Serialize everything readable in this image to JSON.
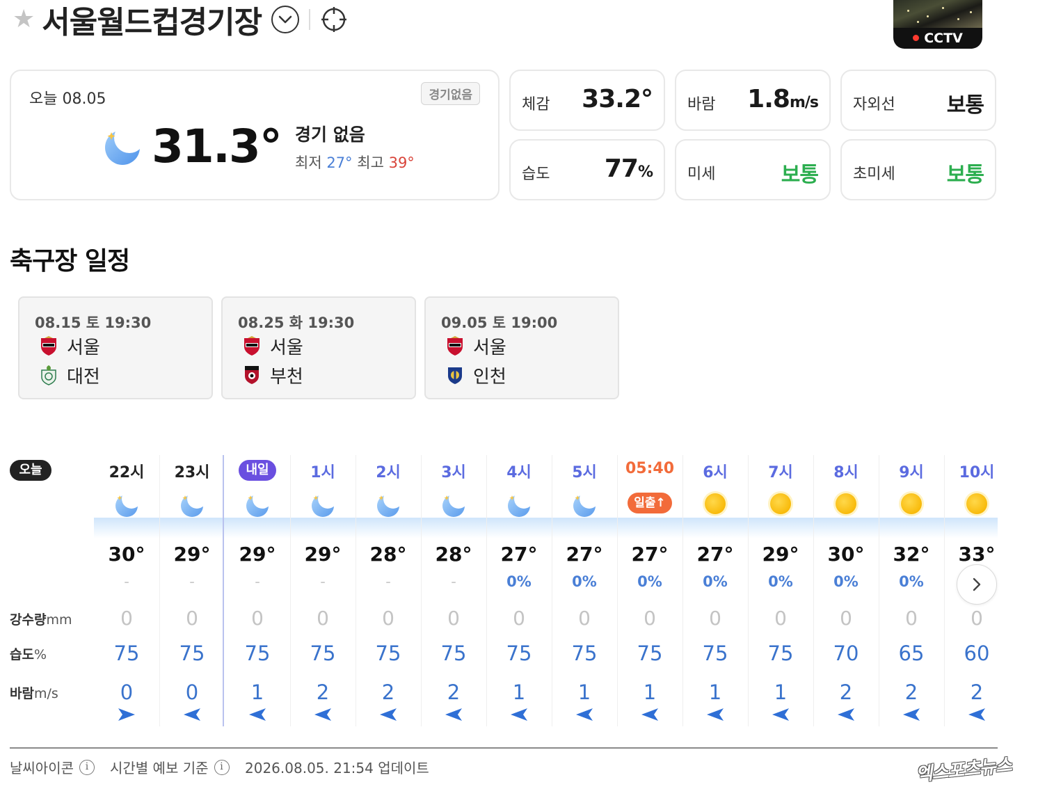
{
  "header": {
    "stadium_name": "서울월드컵경기장",
    "cctv_label": "CCTV"
  },
  "current": {
    "date_label": "오늘 08.05",
    "badge": "경기없음",
    "temp": "31.3°",
    "game_status": "경기 없음",
    "min_label": "최저",
    "min": "27°",
    "max_label": "최고",
    "max": "39°"
  },
  "stats": {
    "feels": {
      "label": "체감",
      "value": "33.2°"
    },
    "wind": {
      "label": "바람",
      "value": "1.8",
      "unit": "m/s"
    },
    "uv": {
      "label": "자외선",
      "value": "보통"
    },
    "humidity": {
      "label": "습도",
      "value": "77",
      "unit": "%"
    },
    "pm10": {
      "label": "미세",
      "value": "보통"
    },
    "pm25": {
      "label": "초미세",
      "value": "보통"
    }
  },
  "schedule": {
    "title": "축구장 일정",
    "matches": [
      {
        "date": "08.15 토 19:30",
        "home": "서울",
        "away": "대전"
      },
      {
        "date": "08.25 화 19:30",
        "home": "서울",
        "away": "부천"
      },
      {
        "date": "09.05 토 19:00",
        "home": "서울",
        "away": "인천"
      }
    ]
  },
  "hourly": {
    "today_label": "오늘",
    "tomorrow_label": "내일",
    "sunrise_label": "일출↑",
    "row_labels": {
      "rain": "강수량",
      "rain_unit": "mm",
      "humidity": "습도",
      "humidity_unit": "%",
      "wind": "바람",
      "wind_unit": "m/s"
    },
    "hours": [
      {
        "hour": "22시",
        "icon": "moon-icon",
        "temp": "30°",
        "prob": "-",
        "rain": "0",
        "humidity": "75",
        "wind": "0",
        "arrow": "right"
      },
      {
        "hour": "23시",
        "icon": "moon-icon",
        "temp": "29°",
        "prob": "-",
        "rain": "0",
        "humidity": "75",
        "wind": "0",
        "arrow": "left"
      },
      {
        "hour": "내일",
        "icon": "moon-icon",
        "temp": "29°",
        "prob": "-",
        "rain": "0",
        "humidity": "75",
        "wind": "1",
        "arrow": "left"
      },
      {
        "hour": "1시",
        "icon": "moon-icon",
        "temp": "29°",
        "prob": "-",
        "rain": "0",
        "humidity": "75",
        "wind": "2",
        "arrow": "left"
      },
      {
        "hour": "2시",
        "icon": "moon-icon",
        "temp": "28°",
        "prob": "-",
        "rain": "0",
        "humidity": "75",
        "wind": "2",
        "arrow": "left"
      },
      {
        "hour": "3시",
        "icon": "moon-icon",
        "temp": "28°",
        "prob": "-",
        "rain": "0",
        "humidity": "75",
        "wind": "2",
        "arrow": "left"
      },
      {
        "hour": "4시",
        "icon": "moon-icon",
        "temp": "27°",
        "prob": "0%",
        "rain": "0",
        "humidity": "75",
        "wind": "1",
        "arrow": "left"
      },
      {
        "hour": "5시",
        "icon": "moon-icon",
        "temp": "27°",
        "prob": "0%",
        "rain": "0",
        "humidity": "75",
        "wind": "1",
        "arrow": "left"
      },
      {
        "hour": "05:40",
        "icon": "sunrise",
        "temp": "27°",
        "prob": "0%",
        "rain": "0",
        "humidity": "75",
        "wind": "1",
        "arrow": "left"
      },
      {
        "hour": "6시",
        "icon": "sun-icon",
        "temp": "27°",
        "prob": "0%",
        "rain": "0",
        "humidity": "75",
        "wind": "1",
        "arrow": "left"
      },
      {
        "hour": "7시",
        "icon": "sun-icon",
        "temp": "29°",
        "prob": "0%",
        "rain": "0",
        "humidity": "75",
        "wind": "1",
        "arrow": "left"
      },
      {
        "hour": "8시",
        "icon": "sun-icon",
        "temp": "30°",
        "prob": "0%",
        "rain": "0",
        "humidity": "70",
        "wind": "2",
        "arrow": "left"
      },
      {
        "hour": "9시",
        "icon": "sun-icon",
        "temp": "32°",
        "prob": "0%",
        "rain": "0",
        "humidity": "65",
        "wind": "2",
        "arrow": "left"
      },
      {
        "hour": "10시",
        "icon": "sun-icon",
        "temp": "33°",
        "prob": "",
        "rain": "0",
        "humidity": "60",
        "wind": "2",
        "arrow": "left"
      }
    ]
  },
  "footer": {
    "icon_label": "날씨아이콘",
    "basis_label": "시간별 예보 기준",
    "updated": "2026.08.05. 21:54 업데이트",
    "watermark": "엑스포츠뉴스"
  },
  "colors": {
    "good": "#2cae4f",
    "min_temp": "#4a7fd6",
    "max_temp": "#d9443a",
    "tomorrow": "#6a4fe0",
    "sunrise": "#f26b3a",
    "value_blue": "#3a73cc"
  }
}
